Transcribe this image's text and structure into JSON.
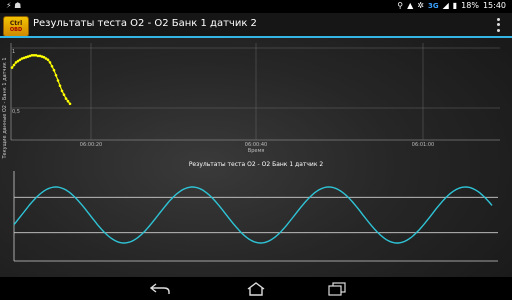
{
  "status_bar": {
    "left_icons": [
      "usb-icon",
      "notification-icon"
    ],
    "network": "3G",
    "battery": "18%",
    "time": "15:40"
  },
  "action_bar": {
    "logo_line1": "Ctrl",
    "logo_line2": "OBD",
    "title": "Результаты теста O2 - O2 Банк 1 датчик 2"
  },
  "chart_data": [
    {
      "type": "scatter",
      "title": "",
      "xlabel": "Время",
      "ylabel": "Текущие данные O2 - Банк 1 датчик 1",
      "x_tick_labels": [
        "06:00:20",
        "06:00:40",
        "06:01:00"
      ],
      "y_tick_labels": [
        "1",
        "0,5"
      ],
      "series": [
        {
          "color": "#ffff00",
          "x": [
            0,
            1,
            2,
            3,
            4,
            5,
            6,
            7,
            8,
            9,
            10,
            11,
            12,
            13,
            14,
            15,
            16,
            17,
            18,
            19,
            20,
            21,
            22,
            23,
            24,
            25,
            26,
            27,
            28,
            29
          ],
          "y": [
            0.86,
            0.88,
            0.9,
            0.91,
            0.92,
            0.93,
            0.935,
            0.94,
            0.945,
            0.95,
            0.955,
            0.955,
            0.955,
            0.95,
            0.95,
            0.945,
            0.94,
            0.93,
            0.92,
            0.9,
            0.87,
            0.84,
            0.8,
            0.76,
            0.72,
            0.68,
            0.65,
            0.62,
            0.6,
            0.58
          ]
        }
      ],
      "grid": true
    },
    {
      "type": "line",
      "title": "Результаты теста O2 - O2 Банк 1 датчик 2",
      "xlabel": "",
      "ylabel": "",
      "series": [
        {
          "color": "#2ec4d6",
          "period": 1,
          "cycles": 3.5,
          "amplitude": 1,
          "offset": 0
        }
      ],
      "reference_lines": [
        0.6,
        -0.6
      ],
      "grid": false
    }
  ]
}
